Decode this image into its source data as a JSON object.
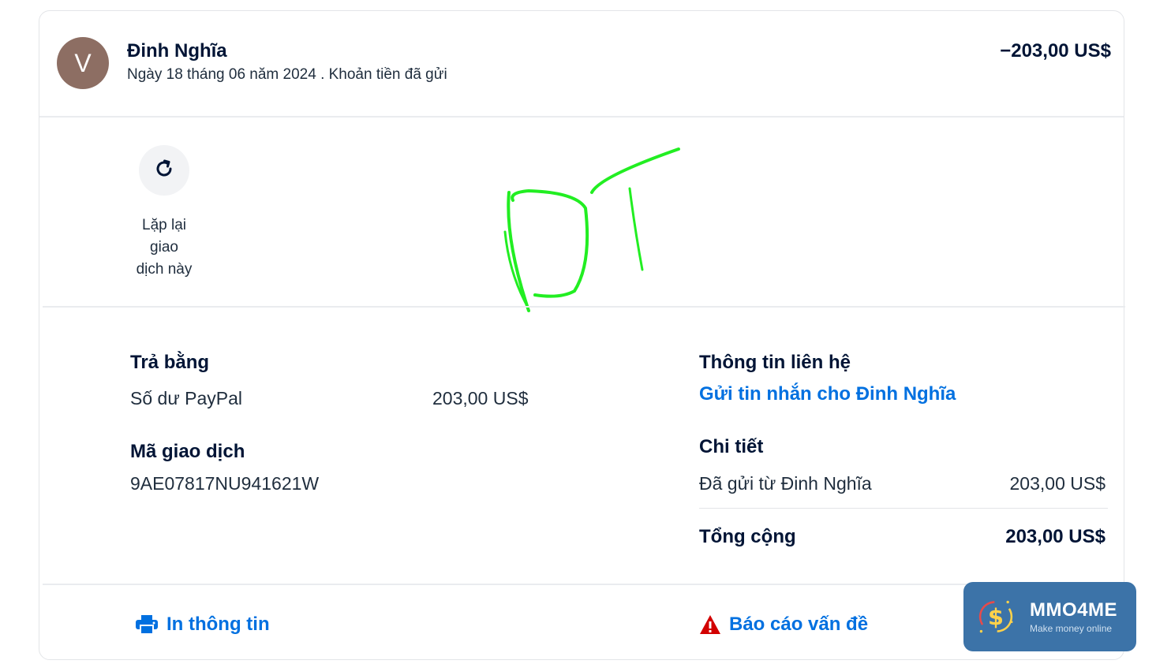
{
  "header": {
    "avatar_letter": "V",
    "name": "Đinh Nghĩa",
    "subtitle": "Ngày 18 tháng 06 năm 2024 . Khoản tiền đã gửi",
    "amount": "−203,00 US$"
  },
  "repeat": {
    "label_line1": "Lặp lại",
    "label_line2": "giao",
    "label_line3": "dịch này"
  },
  "payment": {
    "title": "Trả bằng",
    "method": "Số dư PayPal",
    "amount": "203,00 US$"
  },
  "transaction": {
    "title": "Mã giao dịch",
    "id": "9AE07817NU941621W"
  },
  "contact": {
    "title": "Thông tin liên hệ",
    "message_link": "Gửi tin nhắn cho Đinh Nghĩa"
  },
  "details": {
    "title": "Chi tiết",
    "sent_from_label": "Đã gửi từ Đinh Nghĩa",
    "sent_from_amount": "203,00 US$",
    "total_label": "Tổng cộng",
    "total_amount": "203,00 US$"
  },
  "footer": {
    "print_label": "In thông tin",
    "report_label": "Báo cáo vấn đề"
  },
  "watermark": {
    "title": "MMO4ME",
    "subtitle": "Make money online"
  },
  "colors": {
    "link": "#0070e0",
    "text": "#001435",
    "warning": "#d20000",
    "scribble": "#22ee22",
    "badge": "#3c73a8"
  },
  "icons": [
    "refresh-icon",
    "printer-icon",
    "warning-icon",
    "dollar-coin-icon"
  ]
}
